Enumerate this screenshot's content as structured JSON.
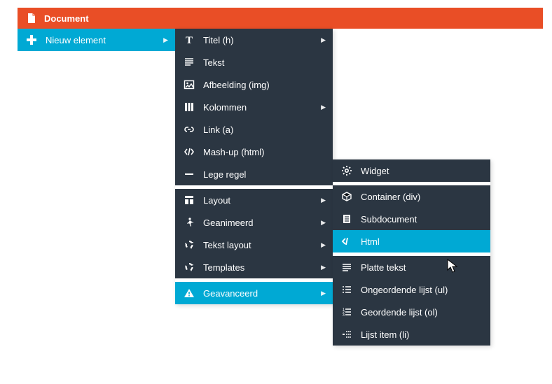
{
  "top": {
    "label": "Document"
  },
  "level1": {
    "label": "Nieuw element"
  },
  "group1": [
    {
      "label": "Titel (h)",
      "icon": "titel",
      "arrow": true
    },
    {
      "label": "Tekst",
      "icon": "tekst",
      "arrow": false
    },
    {
      "label": "Afbeelding (img)",
      "icon": "image",
      "arrow": false
    },
    {
      "label": "Kolommen",
      "icon": "columns",
      "arrow": true
    },
    {
      "label": "Link (a)",
      "icon": "link",
      "arrow": false
    },
    {
      "label": "Mash-up (html)",
      "icon": "code",
      "arrow": false
    },
    {
      "label": "Lege regel",
      "icon": "minus",
      "arrow": false
    }
  ],
  "group2": [
    {
      "label": "Layout",
      "icon": "layout",
      "arrow": true
    },
    {
      "label": "Geanimeerd",
      "icon": "walk",
      "arrow": true
    },
    {
      "label": "Tekst layout",
      "icon": "recycle",
      "arrow": true
    },
    {
      "label": "Templates",
      "icon": "recycle",
      "arrow": true
    }
  ],
  "group3": [
    {
      "label": "Geavanceerd",
      "icon": "warn",
      "arrow": true,
      "hl": true
    }
  ],
  "sub1": [
    {
      "label": "Widget",
      "icon": "gear"
    }
  ],
  "sub2": [
    {
      "label": "Container (div)",
      "icon": "box"
    },
    {
      "label": "Subdocument",
      "icon": "doc"
    },
    {
      "label": "Html",
      "icon": "codeclose",
      "hl": true
    }
  ],
  "sub3": [
    {
      "label": "Platte tekst",
      "icon": "lines"
    },
    {
      "label": "Ongeordende lijst (ul)",
      "icon": "ul"
    },
    {
      "label": "Geordende lijst (ol)",
      "icon": "ol"
    },
    {
      "label": "Lijst item (li)",
      "icon": "li"
    }
  ]
}
